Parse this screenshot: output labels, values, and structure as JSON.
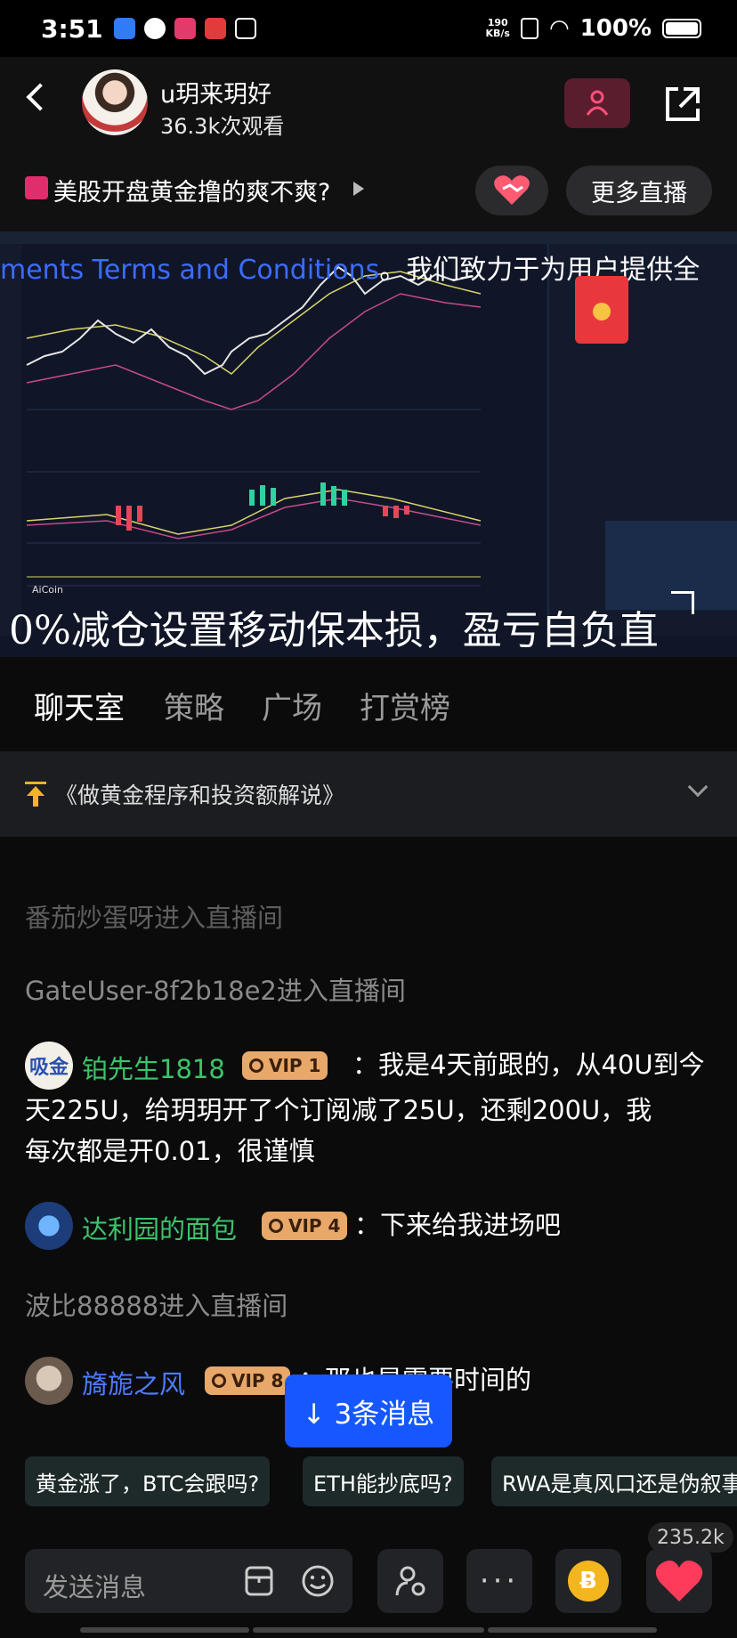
{
  "status": {
    "time": "3:51",
    "net_speed": "190\nKB/s",
    "battery": "100%"
  },
  "header": {
    "anchor_name": "u玥来玥好",
    "viewers": "36.3k次观看"
  },
  "topic": {
    "title": "美股开盘黄金撸的爽不爽?",
    "more_live": "更多直播"
  },
  "video": {
    "ticker_link": "ments  Terms and Conditions",
    "ticker_text": "。我们致力于为用户提供全",
    "caption": "0%减仓设置移动保本损，盈亏自负直",
    "watermark": "AiCoin"
  },
  "tabs": [
    "聊天室",
    "策略",
    "广场",
    "打赏榜"
  ],
  "pinned": {
    "text": "《做黄金程序和投资额解说》"
  },
  "chat": {
    "sys1": "番茄炒蛋呀进入直播间",
    "sys2": "GateUser-8f2b18e2进入直播间",
    "m1": {
      "avatar_text": "吸金",
      "name": "铂先生1818",
      "vip": "VIP 1",
      "line1": "：我是4天前跟的，从40U到今",
      "line2": "天225U，给玥玥开了个订阅减了25U，还剩200U，我",
      "line3": "每次都是开0.01，很谨慎"
    },
    "m2": {
      "name": "达利园的面包",
      "vip": "VIP 4",
      "text": "：下来给我进场吧"
    },
    "sys3": "波比88888进入直播间",
    "m3": {
      "name": "旖旎之风",
      "vip": "VIP 8",
      "text": "：那也是需要时间的"
    }
  },
  "new_messages": "↓ 3条消息",
  "quick_replies": [
    "黄金涨了，BTC会跟吗?",
    "ETH能抄底吗?",
    "RWA是真风口还是伪叙事"
  ],
  "likes": "235.2k",
  "composer": {
    "placeholder": "发送消息"
  },
  "colors": {
    "accent": "#1657ff",
    "username_green": "#3cc46a",
    "username_blue": "#4d7cff",
    "vip": "#e8a86a"
  }
}
